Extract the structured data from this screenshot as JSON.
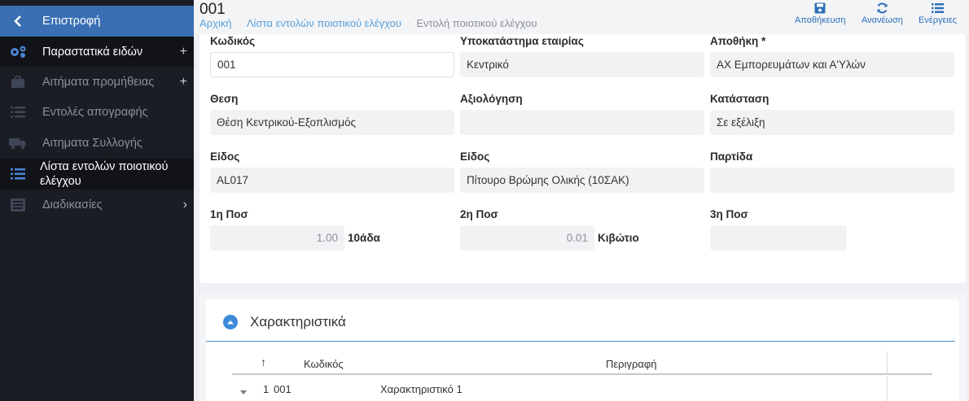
{
  "sidebar": {
    "back_label": "Επιστροφή",
    "items": [
      {
        "label": "Παραστατικά ειδών",
        "icon": "gears-icon",
        "trail": "+"
      },
      {
        "label": "Αιτήματα προμήθειας",
        "icon": "briefcase-icon",
        "trail": "+"
      },
      {
        "label": "Εντολές απογραφής",
        "icon": "list-icon",
        "trail": ""
      },
      {
        "label": "Αιτηματα Συλλογής",
        "icon": "truck-icon",
        "trail": ""
      },
      {
        "label": "Λίστα εντολών ποιοτικού ελέγχου",
        "icon": "list-icon",
        "trail": ""
      },
      {
        "label": "Διαδικασίες",
        "icon": "table-list-icon",
        "trail": "›"
      }
    ]
  },
  "header": {
    "title": "001",
    "breadcrumb": [
      "Αρχική",
      "Λίστα εντολών ποιοτικού ελέγχου",
      "Εντολή ποιοτικού ελέγχου"
    ],
    "actions": {
      "save": "Αποθήκευση",
      "refresh": "Ανανέωση",
      "actions": "Ενέργειες"
    }
  },
  "form": {
    "code_label": "Κωδικός",
    "code_value": "001",
    "branch_label": "Υποκατάστημα εταιρίας",
    "branch_value": "Κεντρικό",
    "warehouse_label": "Αποθήκη *",
    "warehouse_value": "ΑΧ Εμπορευμάτων και Α'Υλών",
    "position_label": "Θεση",
    "position_value": "Θέση Κεντρικού-Εξοπλισμός",
    "rating_label": "Αξιολόγηση",
    "rating_value": "",
    "status_label": "Κατάσταση",
    "status_value": "Σε εξέλιξη",
    "item_code_label": "Είδος",
    "item_code_value": "AL017",
    "item_desc_label": "Είδος",
    "item_desc_value": "Πίτουρο Βρώμης Ολικής (10ΣΑΚ)",
    "batch_label": "Παρτίδα",
    "batch_value": "",
    "qty1_label": "1η Ποσ",
    "qty1_value": "1.00",
    "qty1_unit": "10άδα",
    "qty2_label": "2η Ποσ",
    "qty2_value": "0.01",
    "qty2_unit": "Κιβώτιο",
    "qty3_label": "3η Ποσ",
    "qty3_value": ""
  },
  "characteristics": {
    "title": "Χαρακτηριστικά",
    "columns": {
      "sort": "↑",
      "code": "Κωδικός",
      "desc": "Περιγραφή"
    },
    "rows": [
      {
        "num": "1",
        "code": "001",
        "desc": "Χαρακτηριστικό 1"
      }
    ]
  },
  "colors": {
    "accent": "#3a6fb3",
    "link": "#5aa0d8",
    "sidebar": "#1b1d24"
  }
}
